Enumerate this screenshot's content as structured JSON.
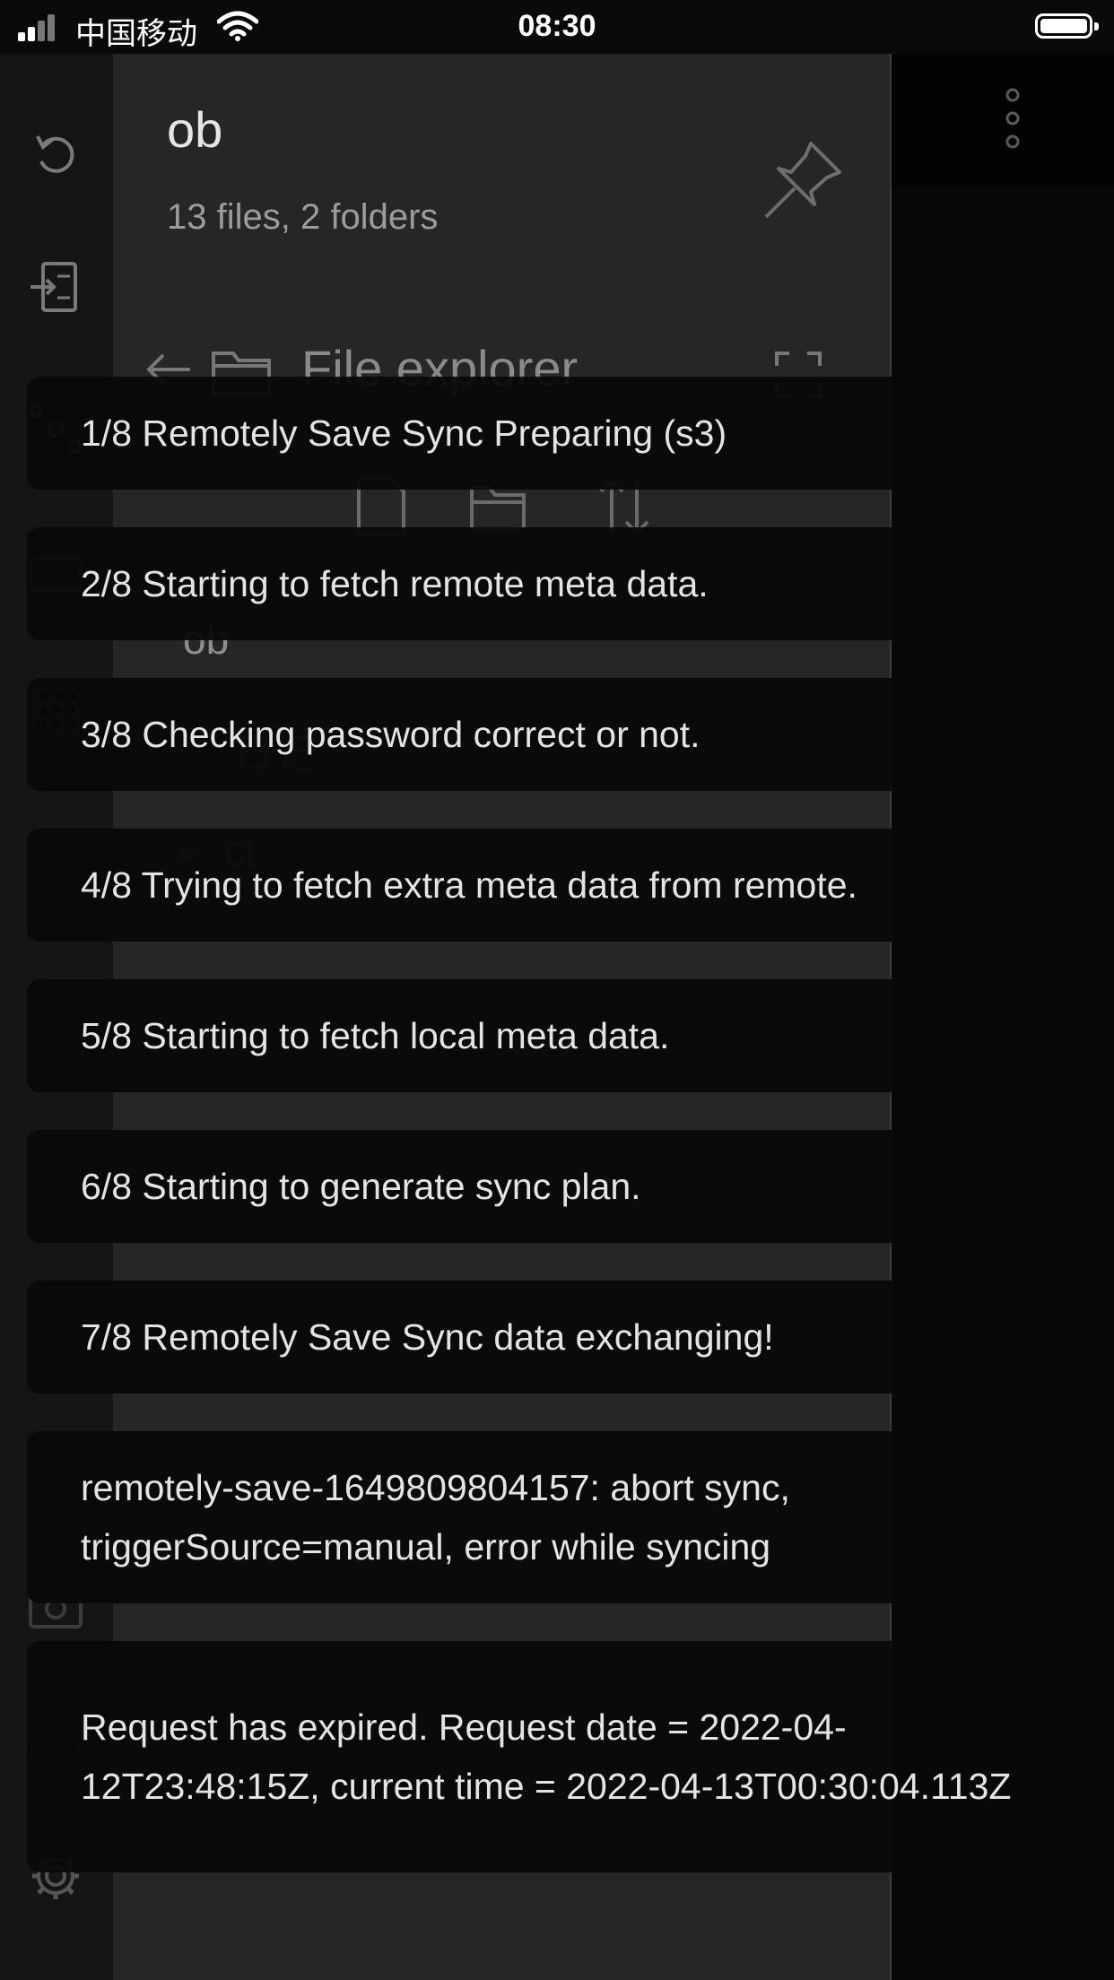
{
  "status_bar": {
    "carrier": "中国移动",
    "time": "08:30"
  },
  "icons": {
    "ribbon": [
      "refresh-icon",
      "import-icon",
      "graph-icon",
      "note-icon",
      "grid-icon",
      "camera-icon",
      "help-icon",
      "settings-icon"
    ],
    "more": "more-vertical-icon",
    "pin": "pin-icon"
  },
  "sidebar": {
    "vault_name": "ob",
    "vault_info": "13 files, 2 folders",
    "file_explorer": {
      "title": "File explorer",
      "tree_root": "ob",
      "items": [
        "日记"
      ],
      "folders": [
        "ct"
      ]
    }
  },
  "notices": [
    "1/8 Remotely Save Sync Preparing (s3)",
    "2/8 Starting to fetch remote meta data.",
    "3/8 Checking password correct or not.",
    "4/8 Trying to fetch extra meta data from remote.",
    "5/8 Starting to fetch local meta data.",
    "6/8 Starting to generate sync plan.",
    "7/8 Remotely Save Sync data exchanging!",
    "remotely-save-1649809804157: abort sync, triggerSource=manual, error while syncing",
    "Request has expired. Request date = 2022-04-12T23:48:15Z, current time = 2022-04-13T00:30:04.113Z"
  ]
}
